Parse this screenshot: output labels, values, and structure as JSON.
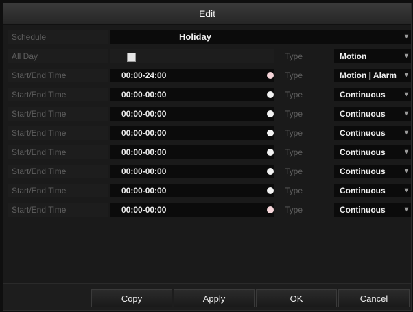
{
  "dialog": {
    "title": "Edit"
  },
  "schedule": {
    "label": "Schedule",
    "value": "Holiday"
  },
  "all_day": {
    "label": "All Day",
    "checked": true,
    "type_label": "Type",
    "type_value": "Motion"
  },
  "rows": [
    {
      "label": "Start/End Time",
      "time": "00:00-24:00",
      "type_label": "Type",
      "type_value": "Motion | Alarm"
    },
    {
      "label": "Start/End Time",
      "time": "00:00-00:00",
      "type_label": "Type",
      "type_value": "Continuous"
    },
    {
      "label": "Start/End Time",
      "time": "00:00-00:00",
      "type_label": "Type",
      "type_value": "Continuous"
    },
    {
      "label": "Start/End Time",
      "time": "00:00-00:00",
      "type_label": "Type",
      "type_value": "Continuous"
    },
    {
      "label": "Start/End Time",
      "time": "00:00-00:00",
      "type_label": "Type",
      "type_value": "Continuous"
    },
    {
      "label": "Start/End Time",
      "time": "00:00-00:00",
      "type_label": "Type",
      "type_value": "Continuous"
    },
    {
      "label": "Start/End Time",
      "time": "00:00-00:00",
      "type_label": "Type",
      "type_value": "Continuous"
    },
    {
      "label": "Start/End Time",
      "time": "00:00-00:00",
      "type_label": "Type",
      "type_value": "Continuous"
    }
  ],
  "buttons": {
    "copy": "Copy",
    "apply": "Apply",
    "ok": "OK",
    "cancel": "Cancel"
  },
  "icons": {
    "dropdown": "chevron-down-icon",
    "color_picker": "color-dot-icon"
  }
}
